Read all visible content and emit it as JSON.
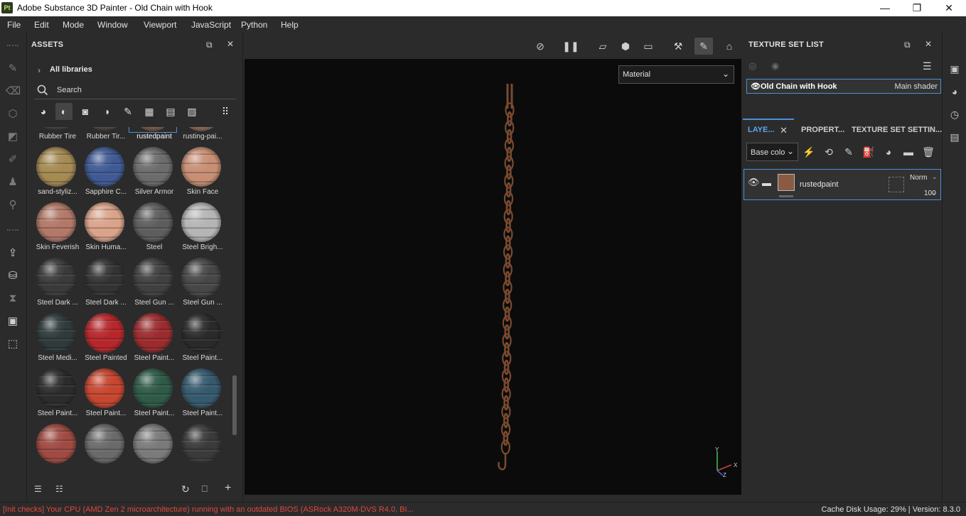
{
  "window": {
    "app_badge": "Pt",
    "title": "Adobe Substance 3D Painter - Old Chain with Hook",
    "minimize": "—",
    "maximize": "❐",
    "close": "✕"
  },
  "menu": [
    "File",
    "Edit",
    "Mode",
    "Window",
    "Viewport",
    "JavaScript",
    "Python",
    "Help"
  ],
  "assets": {
    "title": "ASSETS",
    "library": "All libraries",
    "search_placeholder": "Search",
    "filters": [
      "materials-icon",
      "smart-materials-icon",
      "masks-icon",
      "filters-icon",
      "brushes-icon",
      "alphas-icon",
      "textures-icon",
      "environments-icon",
      "grid-view-icon"
    ],
    "items": [
      {
        "label": "Rubber Tire",
        "color": "#3a3a3a"
      },
      {
        "label": "Rubber Tir...",
        "color": "#4a433f"
      },
      {
        "label": "rustedpaint",
        "color": "#7a5a48",
        "selected": true
      },
      {
        "label": "rusting-pai...",
        "color": "#8b6a58"
      },
      {
        "label": "sand-styliz...",
        "color": "#a58a52"
      },
      {
        "label": "Sapphire C...",
        "color": "#3f5a96"
      },
      {
        "label": "Silver Armor",
        "color": "#6c6c6c"
      },
      {
        "label": "Skin Face",
        "color": "#c98f74"
      },
      {
        "label": "Skin Feverish",
        "color": "#b27868"
      },
      {
        "label": "Skin Huma...",
        "color": "#dba48a"
      },
      {
        "label": "Steel",
        "color": "#5d5d5d"
      },
      {
        "label": "Steel Brigh...",
        "color": "#b5b5b5"
      },
      {
        "label": "Steel Dark ...",
        "color": "#3a3a3a"
      },
      {
        "label": "Steel Dark ...",
        "color": "#333333"
      },
      {
        "label": "Steel Gun ...",
        "color": "#404040"
      },
      {
        "label": "Steel Gun ...",
        "color": "#474747"
      },
      {
        "label": "Steel Medi...",
        "color": "#2f3a3a"
      },
      {
        "label": "Steel Painted",
        "color": "#b8262a"
      },
      {
        "label": "Steel Paint...",
        "color": "#9c2b2e"
      },
      {
        "label": "Steel Paint...",
        "color": "#2a2a2a"
      },
      {
        "label": "Steel Paint...",
        "color": "#2c2c2c"
      },
      {
        "label": "Steel Paint...",
        "color": "#c8452f"
      },
      {
        "label": "Steel Paint...",
        "color": "#2e5a47"
      },
      {
        "label": "Steel Paint...",
        "color": "#355a6e"
      },
      {
        "label": "",
        "color": "#a04a42"
      },
      {
        "label": "",
        "color": "#6a6a6a"
      },
      {
        "label": "",
        "color": "#7a7a7a"
      },
      {
        "label": "",
        "color": "#3a3a3a"
      }
    ]
  },
  "viewport": {
    "material_mode": "Material",
    "axis_x": "X",
    "axis_y": "Y",
    "axis_z": "Z"
  },
  "texture_set_list": {
    "title": "TEXTURE SET LIST",
    "item_name": "Old Chain with Hook",
    "item_shader": "Main shader"
  },
  "layers": {
    "tabs": [
      "LAYE...",
      "PROPERT...",
      "TEXTURE SET SETTIN..."
    ],
    "channel": "Base colo",
    "layer_name": "rustedpaint",
    "blend_mode": "Norm",
    "opacity": "100"
  },
  "status": {
    "error": "[Init checks] Your CPU (AMD Zen 2 microarchitecture) running with an outdated BIOS (ASRock A320M-DVS R4.0, BI...",
    "cache": "Cache Disk Usage:   29% | Version: 8.3.0"
  },
  "colors": {
    "accent": "#4d8fd6",
    "error": "#e3463c",
    "chain": "#7a4a30"
  }
}
